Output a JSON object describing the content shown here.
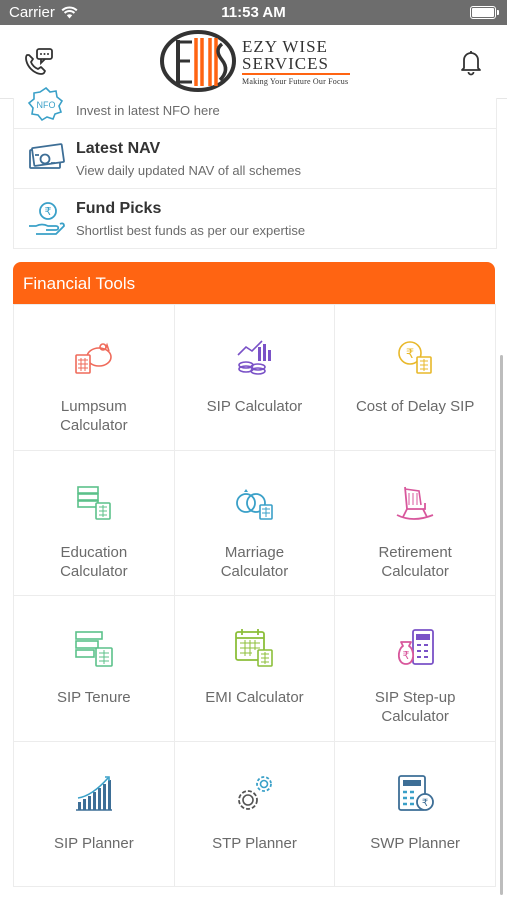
{
  "status": {
    "carrier": "Carrier",
    "time": "11:53 AM"
  },
  "header": {
    "logo_line1": "EZY WISE",
    "logo_line2": "SERVICES",
    "logo_tagline": "Making Your Future Our Focus",
    "left_icon": "phone-chat-icon",
    "right_icon": "bell-icon"
  },
  "menu": {
    "items": [
      {
        "title": "",
        "subtitle": "Invest in latest NFO here",
        "icon": "nfo-icon"
      },
      {
        "title": "Latest NAV",
        "subtitle": "View daily updated NAV of all schemes",
        "icon": "money-icon"
      },
      {
        "title": "Fund Picks",
        "subtitle": "Shortlist best funds as per our expertise",
        "icon": "rupee-hand-icon"
      }
    ]
  },
  "tools": {
    "heading": "Financial Tools",
    "items": [
      {
        "label": "Lumpsum Calculator",
        "icon": "piggy-calculator-icon"
      },
      {
        "label": "SIP Calculator",
        "icon": "coins-chart-icon"
      },
      {
        "label": "Cost of Delay SIP",
        "icon": "rupee-calculator-icon"
      },
      {
        "label": "Education Calculator",
        "icon": "books-calculator-icon"
      },
      {
        "label": "Marriage Calculator",
        "icon": "rings-calculator-icon"
      },
      {
        "label": "Retirement Calculator",
        "icon": "rocking-chair-icon"
      },
      {
        "label": "SIP Tenure",
        "icon": "tenure-calculator-icon"
      },
      {
        "label": "EMI Calculator",
        "icon": "calendar-calculator-icon"
      },
      {
        "label": "SIP Step-up Calculator",
        "icon": "bag-calculator-icon"
      },
      {
        "label": "SIP Planner",
        "icon": "growth-bars-icon"
      },
      {
        "label": "STP Planner",
        "icon": "gears-icon"
      },
      {
        "label": "SWP Planner",
        "icon": "calculator-rupee-icon"
      }
    ]
  },
  "colors": {
    "accent": "#ff6412",
    "status_bar": "#6d6d6d"
  }
}
